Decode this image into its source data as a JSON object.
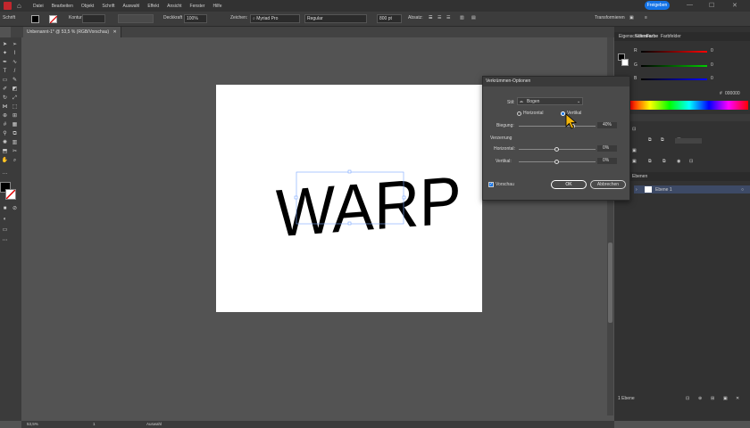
{
  "menubar": {
    "items": [
      "Datei",
      "Bearbeiten",
      "Objekt",
      "Schrift",
      "Auswahl",
      "Effekt",
      "Ansicht",
      "Fenster",
      "Hilfe"
    ],
    "share_label": "Freigeben"
  },
  "controlbar": {
    "context_label": "Schrift",
    "stroke_label": "Kontur",
    "opacity_label": "Deckkraft",
    "opacity_value": "100%",
    "char_label": "Zeichen:",
    "font_name": "Myriad Pro",
    "font_style": "Regular",
    "font_size": "800 pt",
    "paragraph_label": "Absatz:",
    "transform_label": "Transformieren"
  },
  "document": {
    "tab_title": "Unbenannt-1* @ 53,5 % (RGB/Vorschau)",
    "zoom": "53,5%",
    "status_tool": "Auswahl",
    "artwork_text": "WARP"
  },
  "right_panel": {
    "tabs": [
      "Eigenschaften",
      "Ebenen",
      "Farbe",
      "Farbfelder"
    ],
    "active_tab": "Farbe",
    "color": {
      "r_value": "0",
      "g_value": "0",
      "b_value": "0",
      "hex": "000000"
    },
    "layers_label": "Ebenen",
    "layer_name": "Ebene 1",
    "layers_count": "1 Ebene"
  },
  "dialog": {
    "title": "Verkrümmen-Optionen",
    "style_label": "Stil:",
    "style_value": "Bogen",
    "horizontal_label": "Horizontal",
    "vertical_label": "Vertikal",
    "orientation": "Vertikal",
    "bend_label": "Biegung:",
    "bend_value": "40%",
    "bend_fraction": 0.7,
    "distortion_label": "Verzerrung",
    "h_label": "Horizontal:",
    "h_value": "0%",
    "v_label": "Vertikal:",
    "v_value": "0%",
    "preview_label": "Vorschau",
    "ok_label": "OK",
    "cancel_label": "Abbrechen"
  },
  "colors": {
    "accent": "#1473e6",
    "workspace": "#535353",
    "panel": "#323232"
  }
}
